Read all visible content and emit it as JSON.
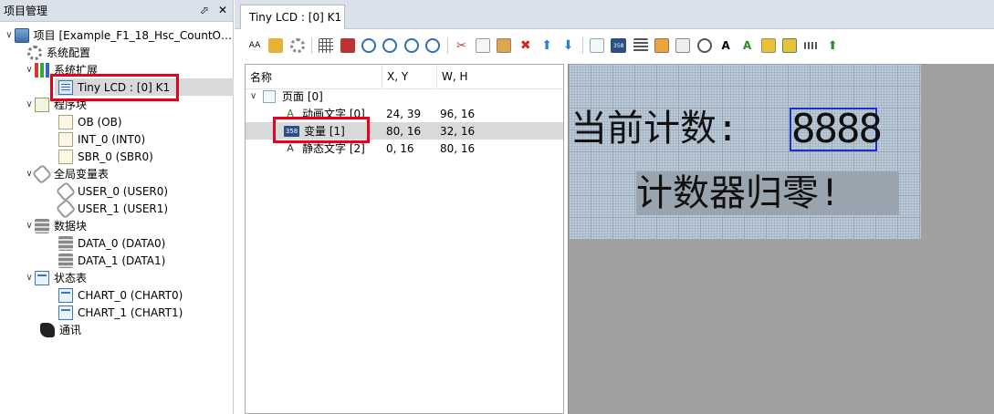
{
  "project_panel": {
    "title": "项目管理",
    "float_btn": "⬀",
    "close_btn": "✕",
    "items": [
      {
        "label": "项目 [Example_F1_18_Hsc_CountO…",
        "arrow": "∨"
      },
      {
        "label": "系统配置"
      },
      {
        "label": "系统扩展",
        "arrow": "∨"
      },
      {
        "label": "Tiny LCD : [0] K1"
      },
      {
        "label": "程序块",
        "arrow": "∨"
      },
      {
        "label": "OB (OB)"
      },
      {
        "label": "INT_0 (INT0)"
      },
      {
        "label": "SBR_0 (SBR0)"
      },
      {
        "label": "全局变量表",
        "arrow": "∨"
      },
      {
        "label": "USER_0 (USER0)"
      },
      {
        "label": "USER_1 (USER1)"
      },
      {
        "label": "数据块",
        "arrow": "∨"
      },
      {
        "label": "DATA_0 (DATA0)"
      },
      {
        "label": "DATA_1 (DATA1)"
      },
      {
        "label": "状态表",
        "arrow": "∨"
      },
      {
        "label": "CHART_0 (CHART0)"
      },
      {
        "label": "CHART_1 (CHART1)"
      },
      {
        "label": "通讯"
      }
    ]
  },
  "tab": {
    "label": "Tiny LCD : [0] K1"
  },
  "toolbar": {
    "font_glyph": "AA",
    "text_glyph": "A",
    "num_badge": "358"
  },
  "element_list": {
    "columns": [
      "名称",
      "X, Y",
      "W, H"
    ],
    "rows": [
      {
        "name": "页面 [0]",
        "arrow": "∨",
        "xy": "",
        "wh": ""
      },
      {
        "name": "动画文字 [0]",
        "xy": "24, 39",
        "wh": "96, 16"
      },
      {
        "name": "变量 [1]",
        "xy": "80, 16",
        "wh": "32, 16",
        "badge": "358"
      },
      {
        "name": "静态文字 [2]",
        "xy": "0, 16",
        "wh": "80, 16"
      }
    ]
  },
  "lcd_preview": {
    "label_text": "当前计数:",
    "variable_text": "8888",
    "static_text": "计数器归零!"
  },
  "colors": {
    "highlight_red": "#e8001c",
    "variable_border": "#1c2fc6",
    "lcd_background": "#bccbd9"
  }
}
